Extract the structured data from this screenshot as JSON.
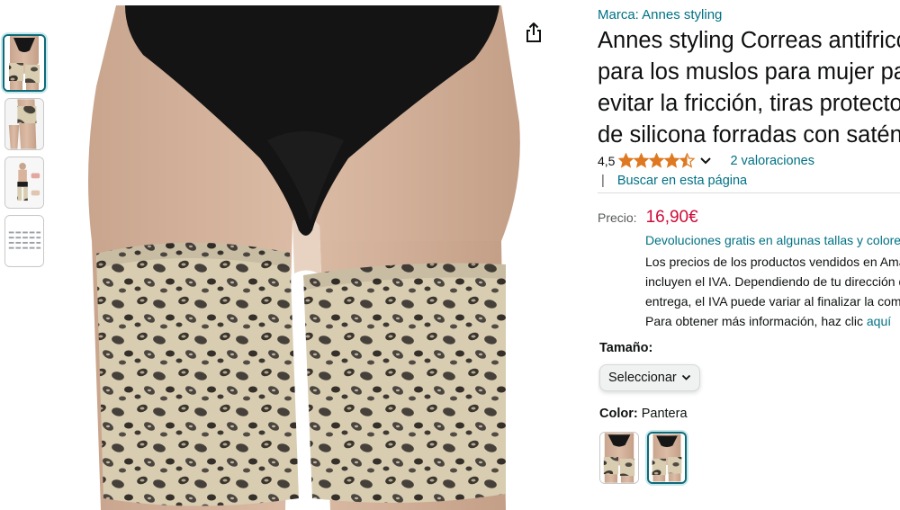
{
  "gallery": {
    "thumbnails": [
      {
        "icon": "leopard-bands-photo-thumbnail",
        "selected": true
      },
      {
        "icon": "side-view-photo-thumbnail",
        "selected": false
      },
      {
        "icon": "lifestyle-photo-thumbnail",
        "selected": false
      },
      {
        "icon": "size-chart-thumbnail",
        "selected": false
      }
    ],
    "share_icon": "share-icon"
  },
  "product": {
    "brand_link": "Marca: Annes styling",
    "title_lines": [
      "Annes styling Correas antifricción",
      "para los muslos para mujer para",
      "evitar la fricción, tiras protectoras",
      "de silicona forradas con satén"
    ],
    "rating_value": "4,5",
    "stars": 4.5,
    "ratings_link": "2 valoraciones",
    "separator": "|",
    "search_link": "Buscar en esta página"
  },
  "price": {
    "label": "Precio:",
    "value": "16,90€",
    "returns_link": "Devoluciones gratis en algunas tallas y colores",
    "vat_lines": [
      "Los precios de los productos vendidos en Amazon",
      "incluyen el IVA. Dependiendo de tu dirección de",
      "entrega, el IVA puede variar al finalizar la compra.",
      "Para obtener más información, haz clic "
    ],
    "vat_link": "aquí"
  },
  "options": {
    "size_label": "Tamaño:",
    "size_select_value": "Seleccionar",
    "color_label": "Color:",
    "color_value": "Pantera"
  },
  "colors": {
    "accent_link": "#007185",
    "price_red": "#cc0c39",
    "star_orange": "#de7921",
    "selected_border": "#0f6a78"
  }
}
